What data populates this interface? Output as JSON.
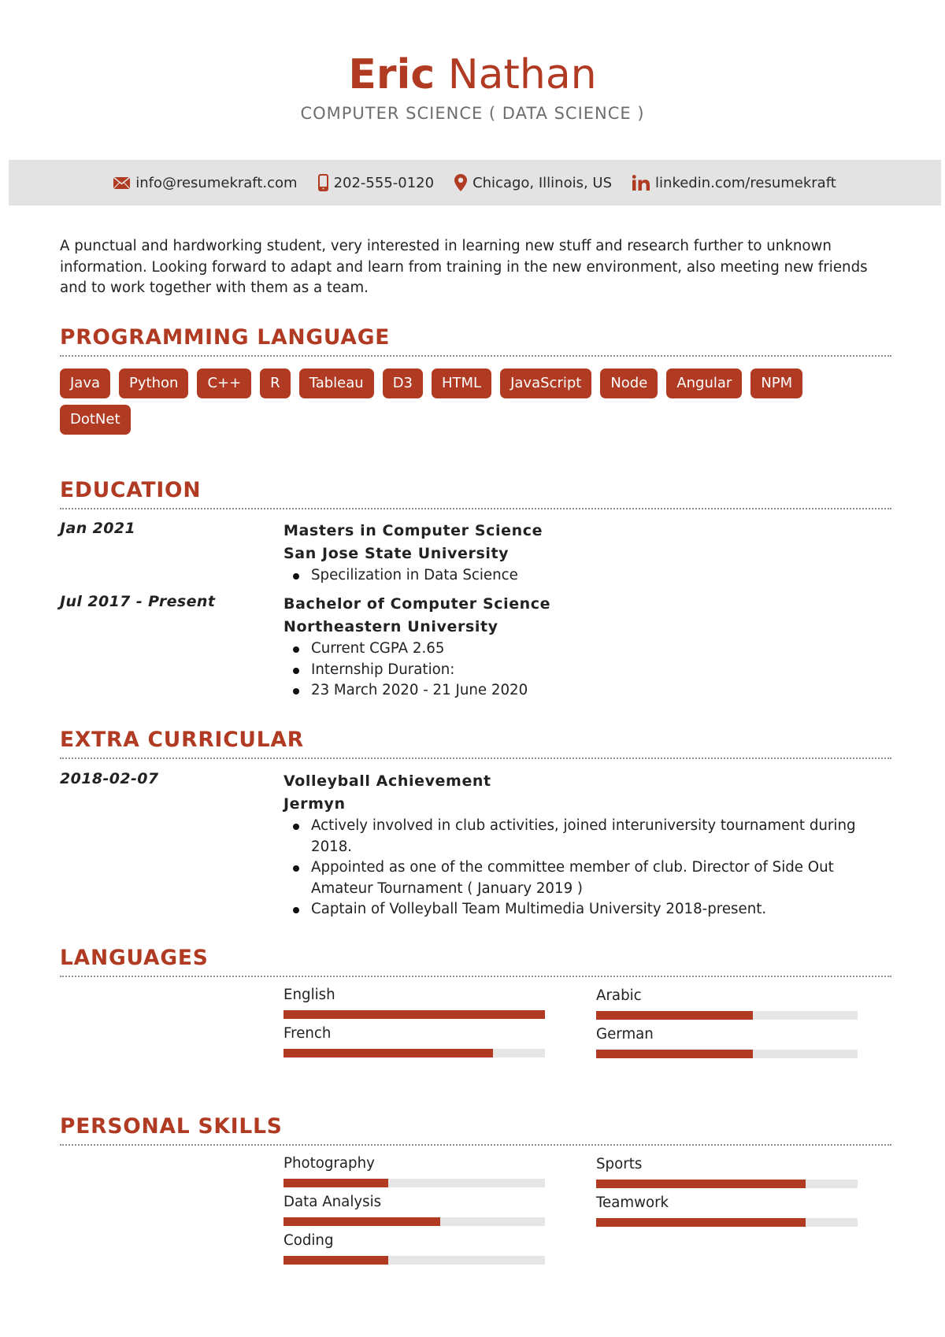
{
  "header": {
    "first_name": "Eric",
    "last_name": "Nathan",
    "subtitle": "COMPUTER SCIENCE ( DATA SCIENCE )"
  },
  "contact": {
    "email": {
      "icon": "envelope-icon",
      "value": "info@resumekraft.com"
    },
    "phone": {
      "icon": "mobile-phone-icon",
      "value": "202-555-0120"
    },
    "location": {
      "icon": "map-pin-icon",
      "value": "Chicago, Illinois, US"
    },
    "linkedin": {
      "icon": "linkedin-icon",
      "value": "linkedin.com/resumekraft"
    }
  },
  "colors": {
    "accent": "#b03a22",
    "contact_bar_bg": "#e3e3e3",
    "bar_track": "#e6e6e6"
  },
  "summary": "A punctual and hardworking student, very interested in learning new stuff and research further to unknown information. Looking forward to adapt and learn from training in the new environment, also meeting new friends and to work together with them as a team.",
  "sections": {
    "programming": "PROGRAMMING LANGUAGE",
    "education": "EDUCATION",
    "extra": "EXTRA CURRICULAR",
    "languages": "LANGUAGES",
    "skills": "PERSONAL SKILLS"
  },
  "programming_languages": [
    "Java",
    "Python",
    "C++",
    "R",
    "Tableau",
    "D3",
    "HTML",
    "JavaScript",
    "Node",
    "Angular",
    "NPM",
    "DotNet"
  ],
  "education": [
    {
      "date": "Jan 2021",
      "degree": "Masters in Computer Science",
      "school": "San Jose State University",
      "bullets": [
        "Specilization in Data Science"
      ]
    },
    {
      "date": "Jul 2017 - Present",
      "degree": "Bachelor of Computer Science",
      "school": "Northeastern University",
      "bullets": [
        "Current CGPA 2.65",
        "Internship Duration:",
        "23 March 2020 - 21 June 2020"
      ]
    }
  ],
  "extra_curricular": [
    {
      "date": "2018-02-07",
      "title": "Volleyball Achievement",
      "org": "Jermyn",
      "bullets": [
        "Actively involved in club activities, joined interuniversity tournament during 2018.",
        "Appointed as one of the committee member of club. Director of Side Out Amateur Tournament ( January 2019 )",
        "Captain of Volleyball Team Multimedia University 2018-present."
      ]
    }
  ],
  "languages": [
    {
      "name": "English",
      "level": 1.0
    },
    {
      "name": "Arabic",
      "level": 0.6
    },
    {
      "name": "French",
      "level": 0.8
    },
    {
      "name": "German",
      "level": 0.6
    }
  ],
  "personal_skills": [
    {
      "name": "Photography",
      "level": 0.4
    },
    {
      "name": "Sports",
      "level": 0.8
    },
    {
      "name": "Data Analysis",
      "level": 0.6
    },
    {
      "name": "Teamwork",
      "level": 0.8
    },
    {
      "name": "Coding",
      "level": 0.4
    }
  ]
}
